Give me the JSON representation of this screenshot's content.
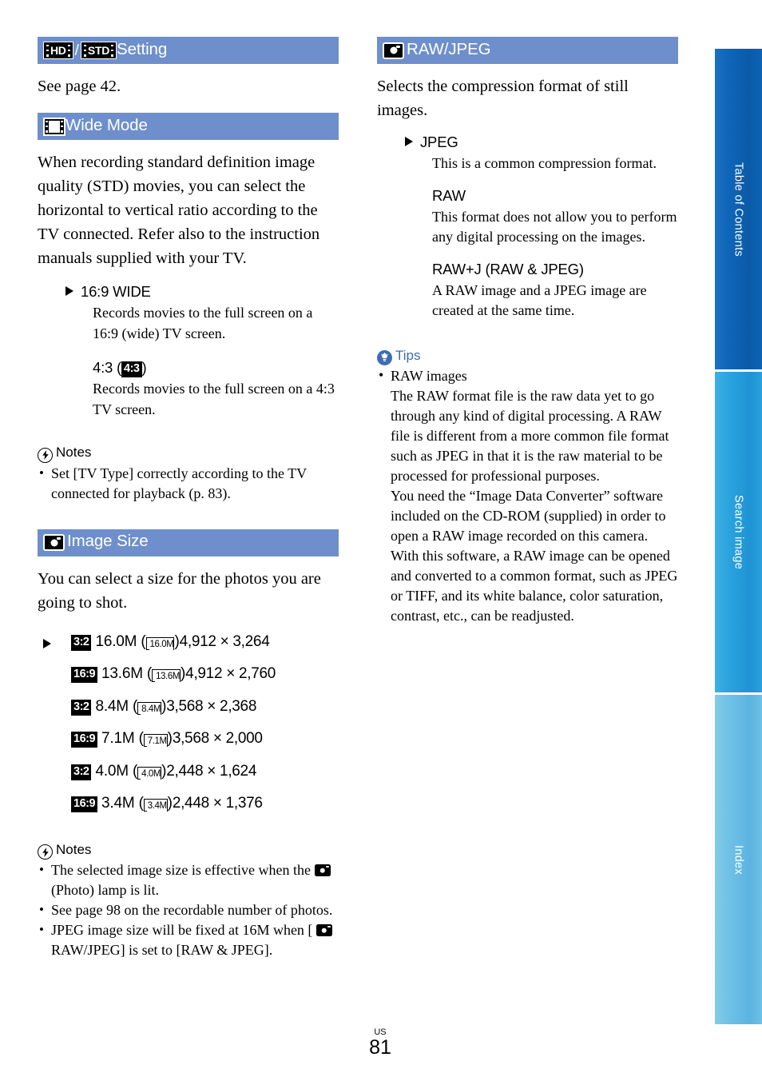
{
  "page": {
    "locale_mark": "US",
    "number": "81",
    "header_bar_color": "#6e8fcb",
    "tips_accent_color": "#3f6cb5"
  },
  "side_tabs": [
    {
      "label": "Table of Contents",
      "color": "#0f66b8"
    },
    {
      "label": "Search image",
      "color": "#2aa3de"
    },
    {
      "label": "Index",
      "color": "#6fc1e6"
    }
  ],
  "left_column": {
    "section_hdstd": {
      "icon_hd": "hd-film-badge-icon",
      "icon_std": "std-film-badge-icon",
      "hd_label": "HD",
      "std_label": "STD",
      "separator": "/",
      "title": "Setting",
      "body": "See page 42."
    },
    "section_wide_mode": {
      "icon": "film-frame-icon",
      "title": "Wide Mode",
      "body": "When recording standard definition image quality (STD) movies, you can select the horizontal to vertical ratio according to the TV connected. Refer also to the instruction manuals supplied with your TV.",
      "options": [
        {
          "name": "16:9 WIDE",
          "selected": true,
          "desc": "Records movies to the full screen on a 16:9 (wide) TV screen."
        },
        {
          "name_prefix": "4:3 (",
          "badge": "4:3",
          "name_suffix": ")",
          "selected": false,
          "desc": "Records movies to the full screen on a 4:3 TV screen."
        }
      ],
      "notes": {
        "icon": "notes-bolt-icon",
        "title": "Notes",
        "items": [
          "Set [TV Type] correctly according to the TV connected for playback (p. 83)."
        ]
      }
    },
    "section_image_size": {
      "icon": "camera-icon",
      "title": "Image Size",
      "body": "You can select a size for the photos you are going to shot.",
      "sizes": [
        {
          "selected": true,
          "ratio": "3:2",
          "mp": "16.0M",
          "glyph": "16.0M",
          "dims": "4,912 × 3,264"
        },
        {
          "selected": false,
          "ratio": "16:9",
          "mp": "13.6M",
          "glyph": "13.6M",
          "dims": "4,912 × 2,760"
        },
        {
          "selected": false,
          "ratio": "3:2",
          "mp": "8.4M",
          "glyph": "8.4M",
          "dims": "3,568 × 2,368"
        },
        {
          "selected": false,
          "ratio": "16:9",
          "mp": "7.1M",
          "glyph": "7.1M",
          "dims": "3,568 × 2,000"
        },
        {
          "selected": false,
          "ratio": "3:2",
          "mp": "4.0M",
          "glyph": "4.0M",
          "dims": "2,448 × 1,624"
        },
        {
          "selected": false,
          "ratio": "16:9",
          "mp": "3.4M",
          "glyph": "3.4M",
          "dims": "2,448 × 1,376"
        }
      ],
      "notes": {
        "icon": "notes-bolt-icon",
        "title": "Notes",
        "item1_a": "The selected image size is effective when the",
        "item1_b": "(Photo) lamp is lit.",
        "item2": "See page 98 on the recordable number of photos.",
        "item3_a": "JPEG image size will be fixed at 16M when [",
        "item3_b": "RAW/JPEG] is set to [RAW & JPEG]."
      }
    }
  },
  "right_column": {
    "section_raw_jpeg": {
      "icon": "camera-icon",
      "title": "RAW/JPEG",
      "body": "Selects the compression format of still images.",
      "options": [
        {
          "name": "JPEG",
          "selected": true,
          "desc": "This is a common compression format."
        },
        {
          "name": "RAW",
          "selected": false,
          "desc": "This format does not allow you to perform any digital processing on the images."
        },
        {
          "name": "RAW+J (RAW & JPEG)",
          "selected": false,
          "desc": "A RAW image and a JPEG image are created at the same time."
        }
      ],
      "tips": {
        "icon": "tips-bulb-icon",
        "title": "Tips",
        "heading": "RAW images",
        "para1": "The RAW format file is the raw data yet to go through any kind of digital processing. A RAW file is different from a more common file format such as JPEG in that it is the raw material to be processed for professional purposes.",
        "para2": "You need the “Image Data Converter” software included on the CD-ROM (supplied) in order to open a RAW image recorded on this camera. With this software, a RAW image can be opened and converted to a common format, such as JPEG or TIFF, and its white balance, color saturation, contrast, etc., can be readjusted."
      }
    }
  }
}
